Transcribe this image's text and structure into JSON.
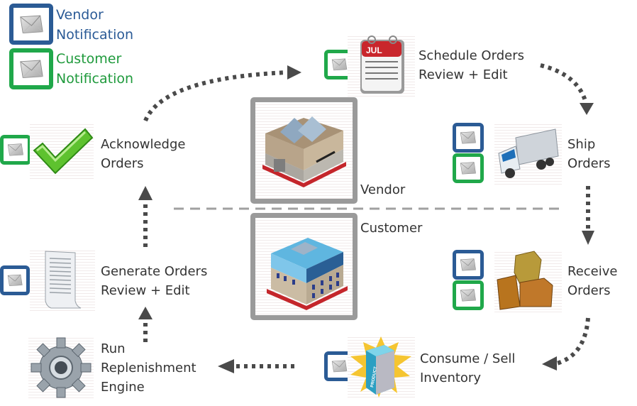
{
  "legend": {
    "vendor": {
      "line1": "Vendor",
      "line2": "Notification",
      "color": "#2b5b95",
      "icon": "envelope-icon"
    },
    "customer": {
      "line1": "Customer",
      "line2": "Notification",
      "color": "#20a84a",
      "icon": "envelope-icon"
    }
  },
  "zones": {
    "vendor_label": "Vendor",
    "customer_label": "Customer",
    "vendor_icon": "factory-building-icon",
    "customer_icon": "office-building-icon"
  },
  "steps": [
    {
      "id": "acknowledge",
      "line1": "Acknowledge",
      "line2": "Orders",
      "icon": "checkmark-icon",
      "notifications": [
        "customer"
      ]
    },
    {
      "id": "schedule",
      "line1": "Schedule Orders",
      "line2": "Review + Edit",
      "icon": "calendar-icon",
      "calendar_month": "JUL",
      "notifications": [
        "customer"
      ]
    },
    {
      "id": "ship",
      "line1": "Ship",
      "line2": "Orders",
      "icon": "truck-icon",
      "notifications": [
        "vendor",
        "customer"
      ]
    },
    {
      "id": "receive",
      "line1": "Receive",
      "line2": "Orders",
      "icon": "crates-icon",
      "notifications": [
        "vendor",
        "customer"
      ]
    },
    {
      "id": "consume",
      "line1": "Consume / Sell",
      "line2": "Inventory",
      "icon": "product-box-icon",
      "product_label": "PRODUCT",
      "notifications": [
        "vendor"
      ]
    },
    {
      "id": "replenish",
      "line1": "Run",
      "line2": "Replenishment",
      "line3": "Engine",
      "icon": "gear-icon",
      "notifications": []
    },
    {
      "id": "generate",
      "line1": "Generate Orders",
      "line2": "Review + Edit",
      "icon": "spreadsheet-icon",
      "notifications": [
        "vendor"
      ]
    }
  ],
  "colors": {
    "arrow": "#4a4a4a",
    "divider": "#a0a0a0",
    "frame": "#9a9a9a",
    "text": "#333333"
  }
}
